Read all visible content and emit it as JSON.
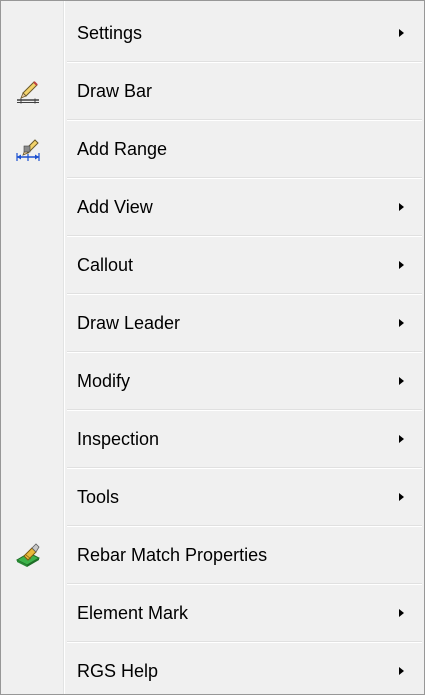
{
  "menu": {
    "items": [
      {
        "label": "Settings",
        "icon": "",
        "submenu": true
      },
      {
        "label": "Draw Bar",
        "icon": "draw-bar-icon",
        "submenu": false
      },
      {
        "label": "Add Range",
        "icon": "add-range-icon",
        "submenu": false
      },
      {
        "label": "Add View",
        "icon": "",
        "submenu": true
      },
      {
        "label": "Callout",
        "icon": "",
        "submenu": true
      },
      {
        "label": "Draw Leader",
        "icon": "",
        "submenu": true
      },
      {
        "label": "Modify",
        "icon": "",
        "submenu": true
      },
      {
        "label": "Inspection",
        "icon": "",
        "submenu": true
      },
      {
        "label": "Tools",
        "icon": "",
        "submenu": true
      },
      {
        "label": "Rebar Match Properties",
        "icon": "match-properties-brush-icon",
        "submenu": false
      },
      {
        "label": "Element Mark",
        "icon": "",
        "submenu": true
      },
      {
        "label": "RGS Help",
        "icon": "",
        "submenu": true
      }
    ]
  },
  "colors": {
    "menu_background": "#f0f0f0",
    "border": "#979797",
    "text": "#000000",
    "separator": "#e0e0e0"
  }
}
